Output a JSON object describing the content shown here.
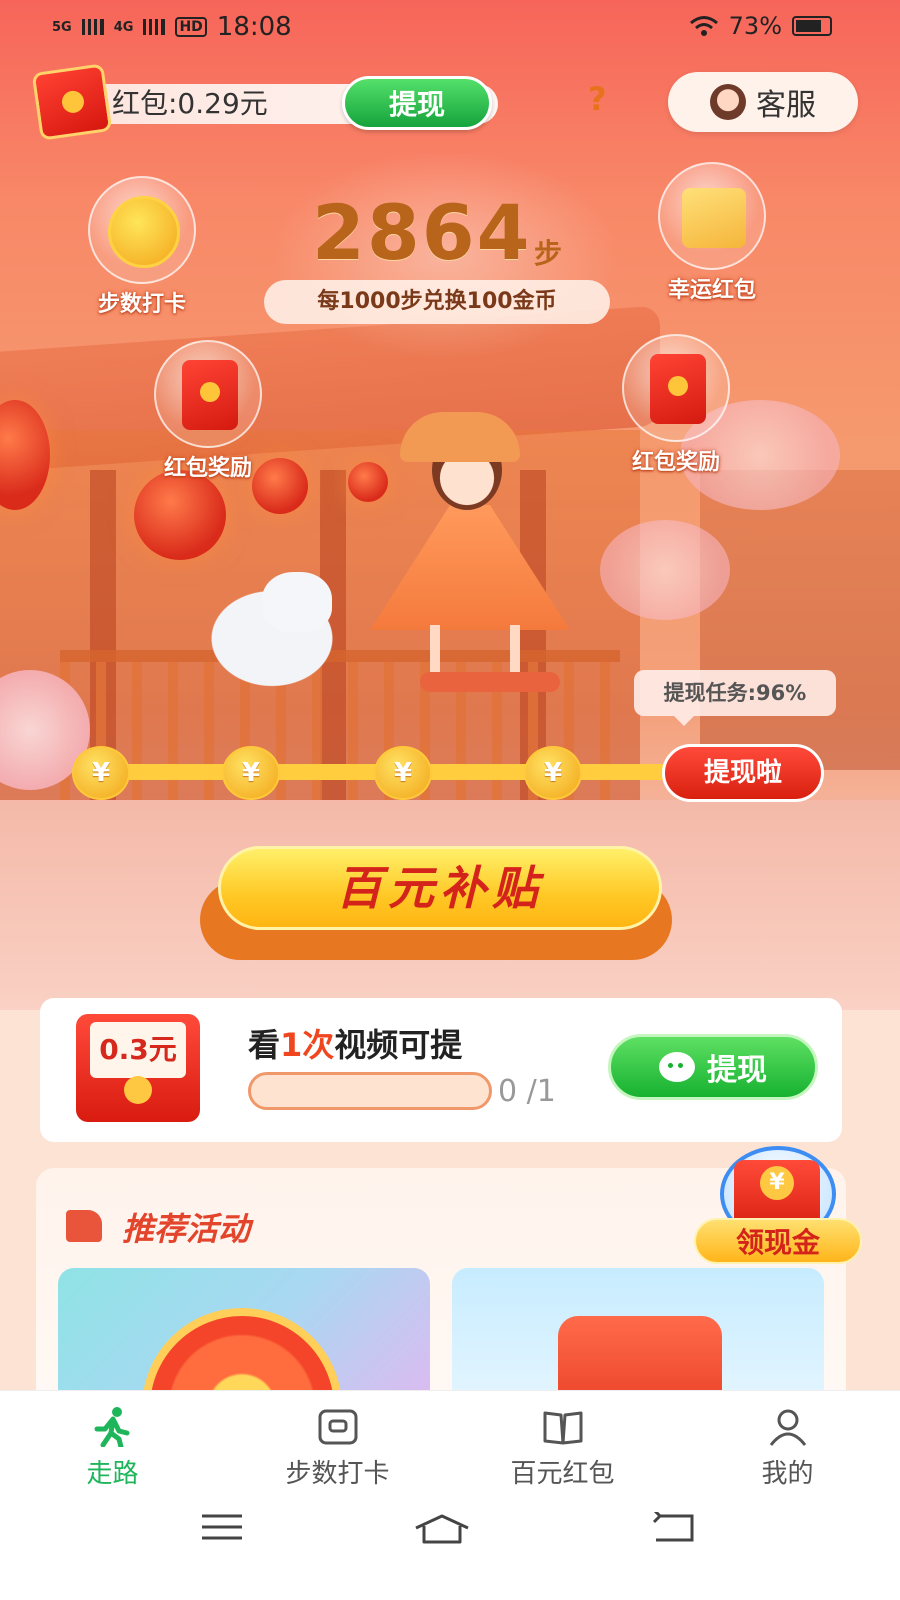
{
  "status_bar": {
    "network1": "5G",
    "network2": "4G",
    "hd": "HD",
    "time": "18:08",
    "battery": "73%"
  },
  "header": {
    "red_packet_balance": "红包:0.29元",
    "withdraw_label": "提现",
    "help_symbol": "?",
    "service_label": "客服"
  },
  "features": {
    "step_checkin": "步数打卡",
    "lucky_red_packet": "幸运红包",
    "red_packet_reward_left": "红包奖励",
    "red_packet_reward_right": "红包奖励"
  },
  "steps": {
    "count": "2864",
    "unit": "步",
    "exchange_rule": "每1000步兑换100金币"
  },
  "progress": {
    "task_label": "提现任务:96%",
    "task_fraction": 0.96,
    "coin_symbol": "¥",
    "cash_button": "提现啦"
  },
  "subsidy": {
    "label": "百元补贴"
  },
  "video_task": {
    "amount": "0.3元",
    "title_prefix": "看",
    "title_highlight": "1次",
    "title_suffix": "视频可提",
    "done": "0",
    "total": " /1",
    "withdraw_label": "提现"
  },
  "recommended": {
    "title": "推荐活动"
  },
  "float_badge": {
    "label": "领现金"
  },
  "bottom_nav": {
    "items": [
      {
        "label": "走路",
        "icon": "walking-icon",
        "active": true
      },
      {
        "label": "步数打卡",
        "icon": "wallet-icon",
        "active": false
      },
      {
        "label": "百元红包",
        "icon": "book-icon",
        "active": false
      },
      {
        "label": "我的",
        "icon": "person-icon",
        "active": false
      }
    ]
  },
  "colors": {
    "accent_green": "#1fb55a",
    "accent_red": "#d9200f",
    "accent_gold": "#ffc825"
  }
}
